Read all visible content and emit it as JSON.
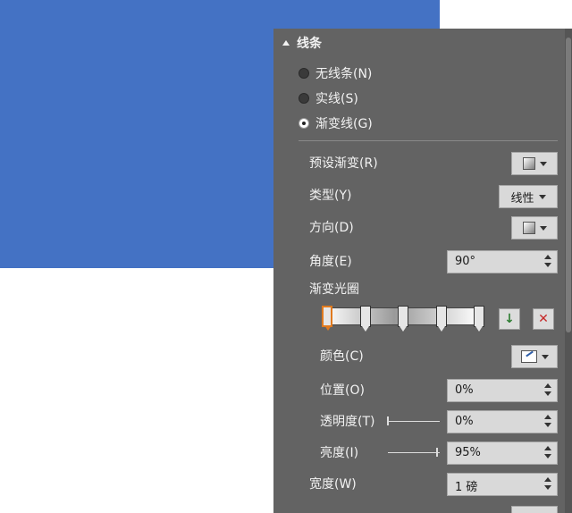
{
  "colors": {
    "shape_fill": "#4472c4",
    "panel_bg": "#636363",
    "selected_stop": "#e07a1f"
  },
  "section": {
    "title": "线条",
    "collapse_icon": "triangle-up-icon"
  },
  "line_type": {
    "options": [
      {
        "label": "无线条(N)",
        "checked": false
      },
      {
        "label": "实线(S)",
        "checked": false
      },
      {
        "label": "渐变线(G)",
        "checked": true
      }
    ]
  },
  "preset": {
    "label": "预设渐变(R)"
  },
  "type": {
    "label": "类型(Y)",
    "value": "线性"
  },
  "direction": {
    "label": "方向(D)"
  },
  "angle": {
    "label": "角度(E)",
    "value": "90°"
  },
  "stops": {
    "label": "渐变光圈",
    "count": 5,
    "selected_index": 0,
    "add_button": "add-stop-icon",
    "remove_button": "remove-stop-icon"
  },
  "color": {
    "label": "颜色(C)"
  },
  "position": {
    "label": "位置(O)",
    "value": "0%"
  },
  "transparency": {
    "label": "透明度(T)",
    "value": "0%",
    "level": 0
  },
  "brightness": {
    "label": "亮度(I)",
    "value": "95%",
    "level": 0.95
  },
  "width": {
    "label": "宽度(W)",
    "value": "1 磅"
  }
}
